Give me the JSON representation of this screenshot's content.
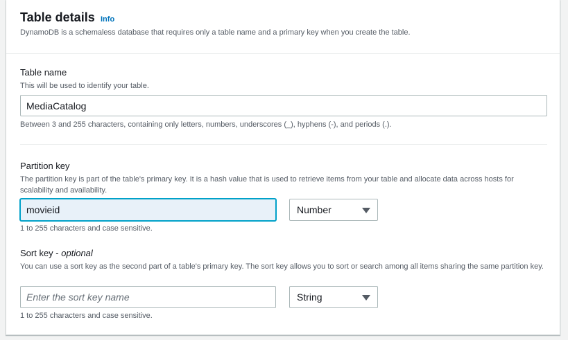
{
  "header": {
    "title": "Table details",
    "info_label": "Info",
    "description": "DynamoDB is a schemaless database that requires only a table name and a primary key when you create the table."
  },
  "table_name": {
    "label": "Table name",
    "description": "This will be used to identify your table.",
    "value": "MediaCatalog",
    "constraint": "Between 3 and 255 characters, containing only letters, numbers, underscores (_), hyphens (-), and periods (.)."
  },
  "partition_key": {
    "label": "Partition key",
    "description": "The partition key is part of the table's primary key. It is a hash value that is used to retrieve items from your table and allocate data across hosts for scalability and availability.",
    "value": "movieid",
    "type": "Number",
    "constraint": "1 to 255 characters and case sensitive."
  },
  "sort_key": {
    "label": "Sort key - ",
    "label_optional": "optional",
    "description": "You can use a sort key as the second part of a table's primary key. The sort key allows you to sort or search among all items sharing the same partition key.",
    "value": "",
    "placeholder": "Enter the sort key name",
    "type": "String",
    "constraint": "1 to 255 characters and case sensitive."
  },
  "icons": {
    "dropdown": "caret-down-icon"
  },
  "colors": {
    "link": "#0073bb",
    "focus_border": "#00a1c9",
    "focus_background": "#e8f1f9"
  }
}
